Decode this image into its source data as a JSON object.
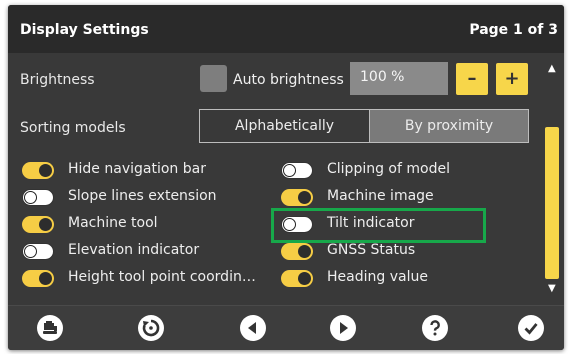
{
  "header": {
    "title": "Display Settings",
    "page_indicator": "Page 1 of 3"
  },
  "brightness": {
    "label": "Brightness",
    "auto_label": "Auto brightness",
    "auto_checked": false,
    "value": "100 %",
    "minus_label": "–",
    "plus_label": "+"
  },
  "sorting": {
    "label": "Sorting models",
    "options": [
      "Alphabetically",
      "By proximity"
    ],
    "selected": "By proximity"
  },
  "toggles_left": [
    {
      "label": "Hide navigation bar",
      "on": true
    },
    {
      "label": "Slope lines extension",
      "on": false
    },
    {
      "label": "Machine tool",
      "on": true
    },
    {
      "label": "Elevation indicator",
      "on": false
    },
    {
      "label": "Height tool point coordin…",
      "on": true
    }
  ],
  "toggles_right": [
    {
      "label": "Clipping of model",
      "on": false
    },
    {
      "label": "Machine image",
      "on": true
    },
    {
      "label": "Tilt indicator",
      "on": false
    },
    {
      "label": "GNSS Status",
      "on": true
    },
    {
      "label": "Heading value",
      "on": true
    }
  ],
  "highlight_color": "#17a84a",
  "accent_color": "#f7d64a",
  "bottom_toolbar": [
    "machine-settings-icon",
    "reset-icon",
    "previous-icon",
    "next-icon",
    "help-icon",
    "confirm-icon"
  ]
}
